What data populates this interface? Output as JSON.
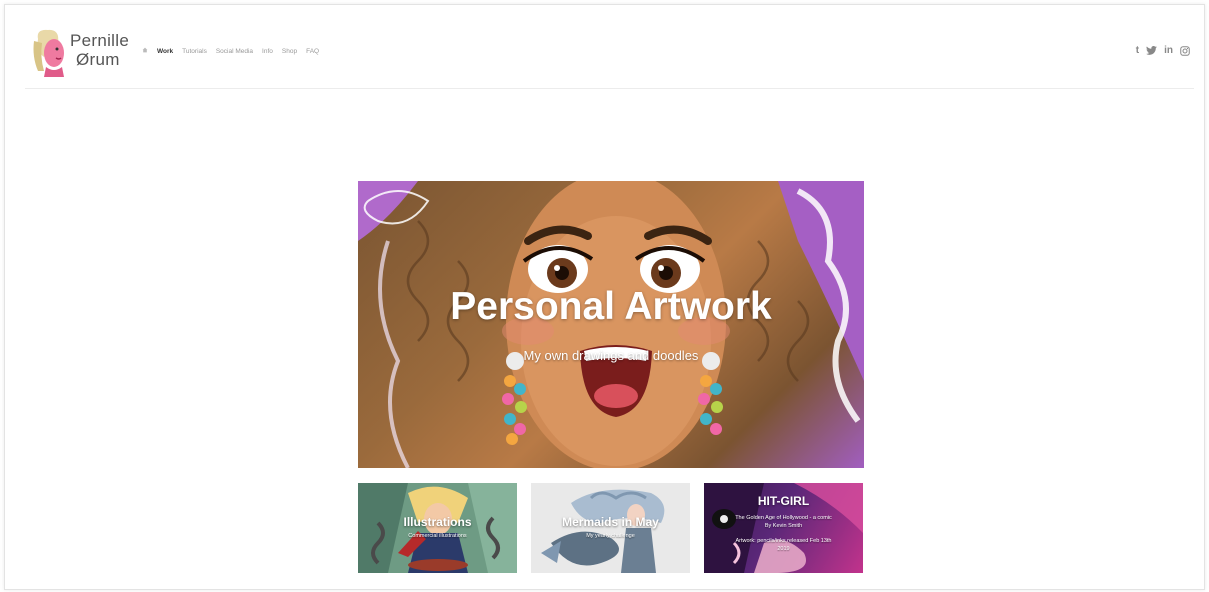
{
  "brand": {
    "logo_line1": "Pernille",
    "logo_line2": "Ørum"
  },
  "nav": {
    "home_icon": "home-icon",
    "items": [
      {
        "label": "Work",
        "active": true
      },
      {
        "label": "Tutorials",
        "active": false
      },
      {
        "label": "Social Media",
        "active": false
      },
      {
        "label": "Info",
        "active": false
      },
      {
        "label": "Shop",
        "active": false
      },
      {
        "label": "FAQ",
        "active": false
      }
    ]
  },
  "social": {
    "tumblr": "t",
    "linkedin": "in",
    "icons": [
      "tumblr-icon",
      "twitter-icon",
      "linkedin-icon",
      "instagram-icon"
    ]
  },
  "hero": {
    "title": "Personal Artwork",
    "subtitle": "My own drawings and doodles"
  },
  "tiles": [
    {
      "title": "Illustrations",
      "subtitle": "Commercial illustrations"
    },
    {
      "title": "Mermaids in May",
      "subtitle": "My yearly challenge"
    },
    {
      "title": "HIT-GIRL",
      "lines": [
        "The Golden Age of Hollywood - a comic",
        "By Kevin Smith",
        "Artwork: pencils/inks released Feb 13th",
        "2019"
      ]
    }
  ],
  "colors": {
    "accent_pink": "#c2338c",
    "hero_purple": "#a15ec0",
    "text": "#333333"
  }
}
